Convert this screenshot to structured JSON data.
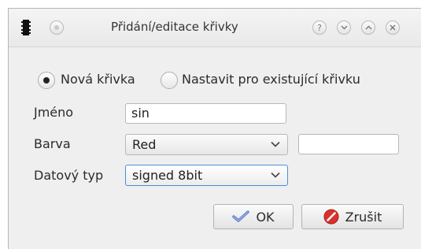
{
  "window": {
    "title": "Přidání/editace křivky",
    "icons": [
      "app-chip-icon",
      "window-menu-icon",
      "help-icon",
      "minimize-icon",
      "maximize-icon",
      "close-icon"
    ]
  },
  "mode": {
    "options": [
      {
        "label": "Nová křivka",
        "selected": true
      },
      {
        "label": "Nastavit pro existující křivku",
        "selected": false
      }
    ]
  },
  "form": {
    "name_label": "Jméno",
    "name_value": "sin",
    "color_label": "Barva",
    "color_value": "Red",
    "color_custom_value": "",
    "type_label": "Datový typ",
    "type_value": "signed 8bit"
  },
  "buttons": {
    "ok_label": "OK",
    "cancel_label": "Zrušit"
  },
  "colors": {
    "ok_icon": "#5b7fc8",
    "cancel_icon": "#d9312b",
    "focus": "#4a8fd8"
  }
}
